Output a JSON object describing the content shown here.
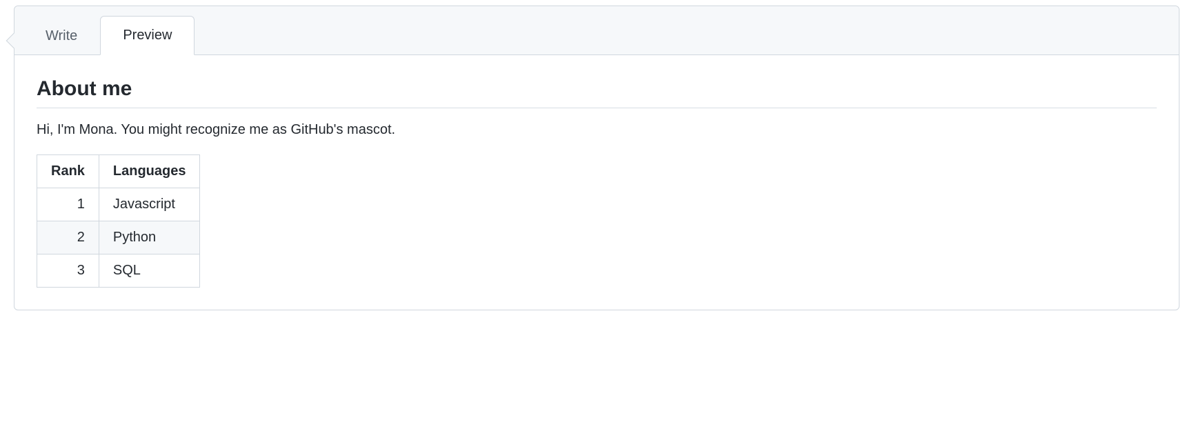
{
  "tabs": {
    "write": "Write",
    "preview": "Preview"
  },
  "content": {
    "heading": "About me",
    "intro": "Hi, I'm Mona. You might recognize me as GitHub's mascot.",
    "table": {
      "headers": {
        "rank": "Rank",
        "languages": "Languages"
      },
      "rows": [
        {
          "rank": "1",
          "language": "Javascript"
        },
        {
          "rank": "2",
          "language": "Python"
        },
        {
          "rank": "3",
          "language": "SQL"
        }
      ]
    }
  }
}
